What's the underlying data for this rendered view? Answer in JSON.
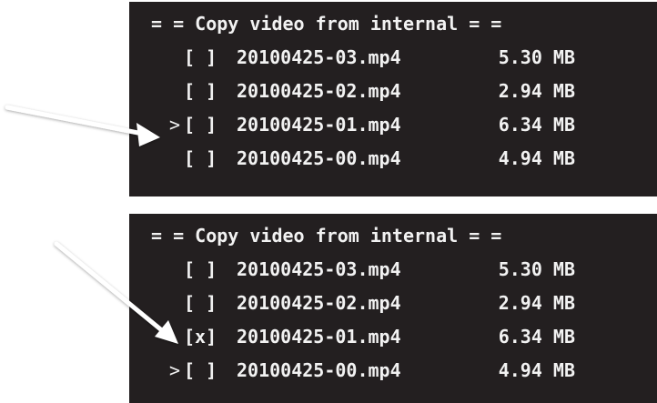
{
  "colors": {
    "panel_bg": "#231f20",
    "text": "#f2f2f2",
    "arrow": "#ffffff"
  },
  "screens": [
    {
      "title": "= = Copy video from internal = =",
      "rows": [
        {
          "cursor": "",
          "checkbox": "[ ]",
          "filename": "20100425-03.mp4",
          "size": "5.30 MB"
        },
        {
          "cursor": "",
          "checkbox": "[ ]",
          "filename": "20100425-02.mp4",
          "size": "2.94 MB"
        },
        {
          "cursor": ">",
          "checkbox": "[ ]",
          "filename": "20100425-01.mp4",
          "size": "6.34 MB"
        },
        {
          "cursor": "",
          "checkbox": "[ ]",
          "filename": "20100425-00.mp4",
          "size": "4.94 MB"
        }
      ]
    },
    {
      "title": "= = Copy video from internal = =",
      "rows": [
        {
          "cursor": "",
          "checkbox": "[ ]",
          "filename": "20100425-03.mp4",
          "size": "5.30 MB"
        },
        {
          "cursor": "",
          "checkbox": "[ ]",
          "filename": "20100425-02.mp4",
          "size": "2.94 MB"
        },
        {
          "cursor": "",
          "checkbox": "[x]",
          "filename": "20100425-01.mp4",
          "size": "6.34 MB"
        },
        {
          "cursor": ">",
          "checkbox": "[ ]",
          "filename": "20100425-00.mp4",
          "size": "4.94 MB"
        }
      ]
    }
  ]
}
